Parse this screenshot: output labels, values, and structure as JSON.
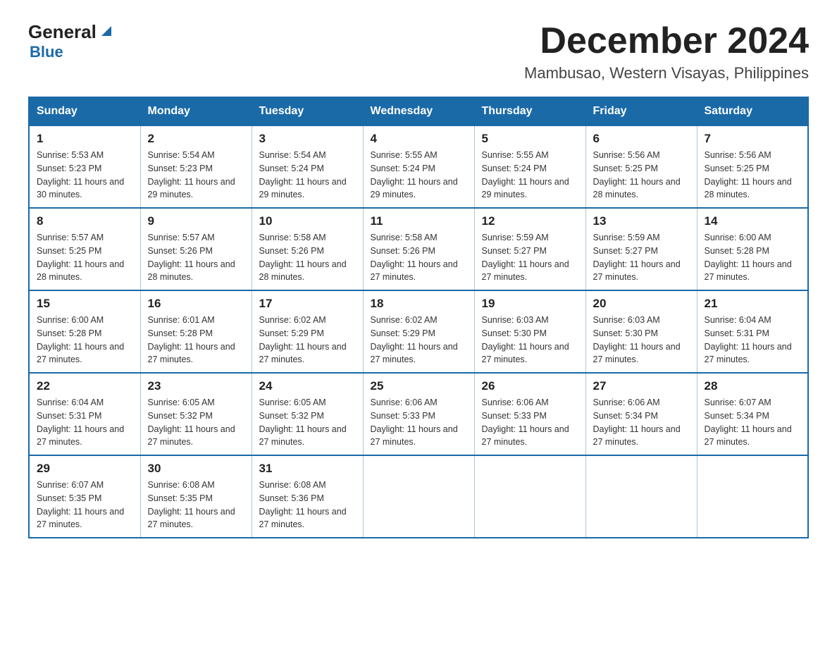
{
  "header": {
    "logo_general": "General",
    "logo_blue": "Blue",
    "logo_arrow": "▶",
    "month_title": "December 2024",
    "location": "Mambusao, Western Visayas, Philippines"
  },
  "days_of_week": [
    "Sunday",
    "Monday",
    "Tuesday",
    "Wednesday",
    "Thursday",
    "Friday",
    "Saturday"
  ],
  "weeks": [
    [
      {
        "day": "1",
        "sunrise": "5:53 AM",
        "sunset": "5:23 PM",
        "daylight": "11 hours and 30 minutes."
      },
      {
        "day": "2",
        "sunrise": "5:54 AM",
        "sunset": "5:23 PM",
        "daylight": "11 hours and 29 minutes."
      },
      {
        "day": "3",
        "sunrise": "5:54 AM",
        "sunset": "5:24 PM",
        "daylight": "11 hours and 29 minutes."
      },
      {
        "day": "4",
        "sunrise": "5:55 AM",
        "sunset": "5:24 PM",
        "daylight": "11 hours and 29 minutes."
      },
      {
        "day": "5",
        "sunrise": "5:55 AM",
        "sunset": "5:24 PM",
        "daylight": "11 hours and 29 minutes."
      },
      {
        "day": "6",
        "sunrise": "5:56 AM",
        "sunset": "5:25 PM",
        "daylight": "11 hours and 28 minutes."
      },
      {
        "day": "7",
        "sunrise": "5:56 AM",
        "sunset": "5:25 PM",
        "daylight": "11 hours and 28 minutes."
      }
    ],
    [
      {
        "day": "8",
        "sunrise": "5:57 AM",
        "sunset": "5:25 PM",
        "daylight": "11 hours and 28 minutes."
      },
      {
        "day": "9",
        "sunrise": "5:57 AM",
        "sunset": "5:26 PM",
        "daylight": "11 hours and 28 minutes."
      },
      {
        "day": "10",
        "sunrise": "5:58 AM",
        "sunset": "5:26 PM",
        "daylight": "11 hours and 28 minutes."
      },
      {
        "day": "11",
        "sunrise": "5:58 AM",
        "sunset": "5:26 PM",
        "daylight": "11 hours and 27 minutes."
      },
      {
        "day": "12",
        "sunrise": "5:59 AM",
        "sunset": "5:27 PM",
        "daylight": "11 hours and 27 minutes."
      },
      {
        "day": "13",
        "sunrise": "5:59 AM",
        "sunset": "5:27 PM",
        "daylight": "11 hours and 27 minutes."
      },
      {
        "day": "14",
        "sunrise": "6:00 AM",
        "sunset": "5:28 PM",
        "daylight": "11 hours and 27 minutes."
      }
    ],
    [
      {
        "day": "15",
        "sunrise": "6:00 AM",
        "sunset": "5:28 PM",
        "daylight": "11 hours and 27 minutes."
      },
      {
        "day": "16",
        "sunrise": "6:01 AM",
        "sunset": "5:28 PM",
        "daylight": "11 hours and 27 minutes."
      },
      {
        "day": "17",
        "sunrise": "6:02 AM",
        "sunset": "5:29 PM",
        "daylight": "11 hours and 27 minutes."
      },
      {
        "day": "18",
        "sunrise": "6:02 AM",
        "sunset": "5:29 PM",
        "daylight": "11 hours and 27 minutes."
      },
      {
        "day": "19",
        "sunrise": "6:03 AM",
        "sunset": "5:30 PM",
        "daylight": "11 hours and 27 minutes."
      },
      {
        "day": "20",
        "sunrise": "6:03 AM",
        "sunset": "5:30 PM",
        "daylight": "11 hours and 27 minutes."
      },
      {
        "day": "21",
        "sunrise": "6:04 AM",
        "sunset": "5:31 PM",
        "daylight": "11 hours and 27 minutes."
      }
    ],
    [
      {
        "day": "22",
        "sunrise": "6:04 AM",
        "sunset": "5:31 PM",
        "daylight": "11 hours and 27 minutes."
      },
      {
        "day": "23",
        "sunrise": "6:05 AM",
        "sunset": "5:32 PM",
        "daylight": "11 hours and 27 minutes."
      },
      {
        "day": "24",
        "sunrise": "6:05 AM",
        "sunset": "5:32 PM",
        "daylight": "11 hours and 27 minutes."
      },
      {
        "day": "25",
        "sunrise": "6:06 AM",
        "sunset": "5:33 PM",
        "daylight": "11 hours and 27 minutes."
      },
      {
        "day": "26",
        "sunrise": "6:06 AM",
        "sunset": "5:33 PM",
        "daylight": "11 hours and 27 minutes."
      },
      {
        "day": "27",
        "sunrise": "6:06 AM",
        "sunset": "5:34 PM",
        "daylight": "11 hours and 27 minutes."
      },
      {
        "day": "28",
        "sunrise": "6:07 AM",
        "sunset": "5:34 PM",
        "daylight": "11 hours and 27 minutes."
      }
    ],
    [
      {
        "day": "29",
        "sunrise": "6:07 AM",
        "sunset": "5:35 PM",
        "daylight": "11 hours and 27 minutes."
      },
      {
        "day": "30",
        "sunrise": "6:08 AM",
        "sunset": "5:35 PM",
        "daylight": "11 hours and 27 minutes."
      },
      {
        "day": "31",
        "sunrise": "6:08 AM",
        "sunset": "5:36 PM",
        "daylight": "11 hours and 27 minutes."
      },
      null,
      null,
      null,
      null
    ]
  ],
  "colors": {
    "header_bg": "#1a6aa8",
    "header_text": "#ffffff",
    "border": "#1a6aa8",
    "cell_border": "#b0c4d8"
  }
}
